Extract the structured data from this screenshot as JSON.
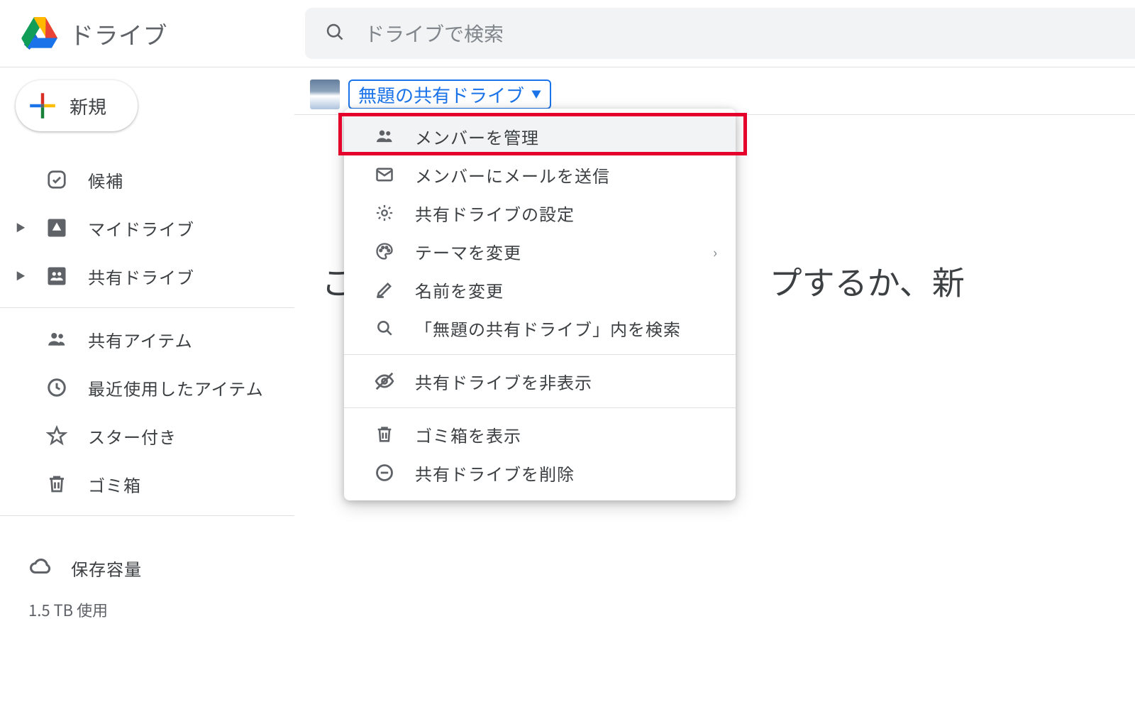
{
  "header": {
    "app_title": "ドライブ",
    "search_placeholder": "ドライブで検索"
  },
  "sidebar": {
    "new_label": "新規",
    "items": [
      {
        "label": "候補",
        "icon": "check-square",
        "expandable": false
      },
      {
        "label": "マイドライブ",
        "icon": "drive-box",
        "expandable": true
      },
      {
        "label": "共有ドライブ",
        "icon": "shared-drive-box",
        "expandable": true
      }
    ],
    "items2": [
      {
        "label": "共有アイテム",
        "icon": "people"
      },
      {
        "label": "最近使用したアイテム",
        "icon": "clock"
      },
      {
        "label": "スター付き",
        "icon": "star"
      },
      {
        "label": "ゴミ箱",
        "icon": "trash"
      }
    ],
    "storage_label": "保存容量",
    "storage_used": "1.5 TB 使用"
  },
  "main": {
    "breadcrumb_title": "無題の共有ドライブ",
    "bg_text_left": "こ",
    "bg_text_right": "プするか、新"
  },
  "menu": {
    "items": [
      {
        "label": "メンバーを管理",
        "icon": "people",
        "hover": true,
        "highlight": true
      },
      {
        "label": "メンバーにメールを送信",
        "icon": "mail"
      },
      {
        "label": "共有ドライブの設定",
        "icon": "gear"
      },
      {
        "label": "テーマを変更",
        "icon": "palette",
        "submenu": true
      },
      {
        "label": "名前を変更",
        "icon": "pencil"
      },
      {
        "label": "「無題の共有ドライブ」内を検索",
        "icon": "search"
      }
    ],
    "items2": [
      {
        "label": "共有ドライブを非表示",
        "icon": "eye-off"
      }
    ],
    "items3": [
      {
        "label": "ゴミ箱を表示",
        "icon": "trash"
      },
      {
        "label": "共有ドライブを削除",
        "icon": "remove-circle"
      }
    ]
  }
}
